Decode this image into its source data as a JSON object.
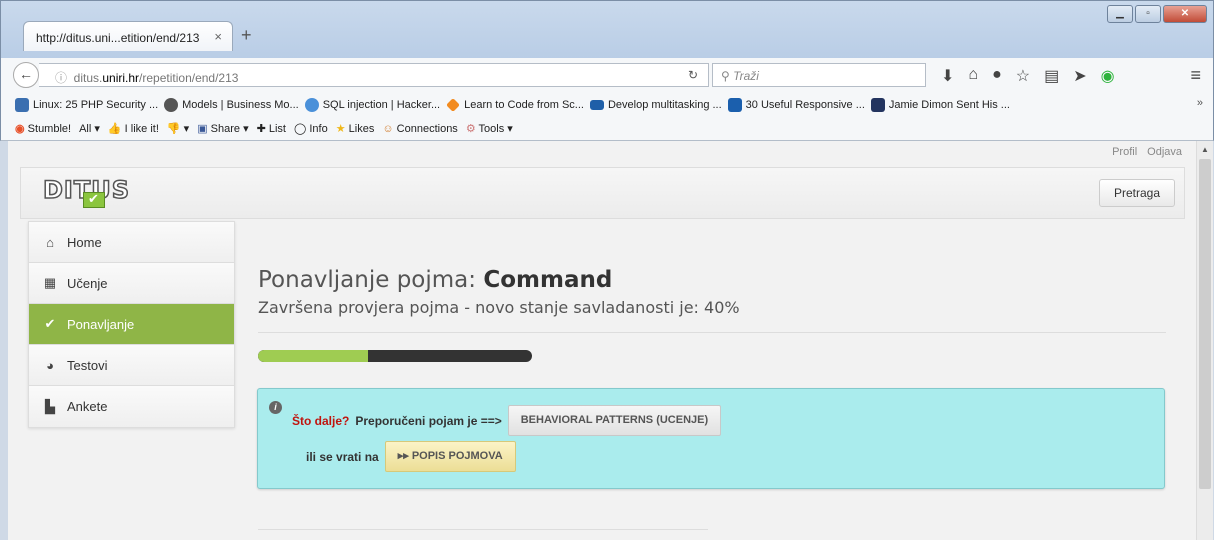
{
  "browser": {
    "tab_title": "http://ditus.uni...etition/end/213",
    "tab_close": "×",
    "new_tab": "+",
    "url_prefix": "ditus.",
    "url_domain": "uniri.hr",
    "url_path": "/repetition/end/213",
    "search_placeholder": "Traži",
    "bookmarks": [
      {
        "label": "Linux: 25 PHP Security ...",
        "color": "#3b6fb0"
      },
      {
        "label": "Models | Business Mo...",
        "color": "#555555"
      },
      {
        "label": "SQL injection | Hacker...",
        "color": "#4a90d9"
      },
      {
        "label": "Learn to Code from Sc...",
        "color": "#f28b20"
      },
      {
        "label": "Develop multitasking ...",
        "color": "#1f5fa8"
      },
      {
        "label": "30 Useful Responsive ...",
        "color": "#1b5fad"
      },
      {
        "label": "Jamie Dimon Sent His ...",
        "color": "#23345f"
      }
    ],
    "toolbar2": {
      "stumble": "Stumble!",
      "all": "All",
      "ilike": "I like it!",
      "share": "Share",
      "list": "List",
      "info": "Info",
      "likes": "Likes",
      "connections": "Connections",
      "tools": "Tools"
    }
  },
  "page": {
    "top_links": {
      "profil": "Profil",
      "odjava": "Odjava"
    },
    "logo_text": "DITUS",
    "search_button": "Pretraga",
    "sidebar": [
      {
        "label": "Home",
        "icon": "home-icon",
        "active": false
      },
      {
        "label": "Učenje",
        "icon": "calendar-icon",
        "active": false
      },
      {
        "label": "Ponavljanje",
        "icon": "check-icon",
        "active": true
      },
      {
        "label": "Testovi",
        "icon": "pie-chart-icon",
        "active": false
      },
      {
        "label": "Ankete",
        "icon": "clipboard-icon",
        "active": false
      }
    ],
    "title_prefix": "Ponavljanje pojma: ",
    "title_term": "Command",
    "subtitle": "Završena provjera pojma - novo stanje savladanosti je: 40%",
    "progress_fraction": 0.4,
    "colors": {
      "progress_fill": "#9fcc52",
      "active_nav": "#8fb547",
      "alert_bg": "#aaeced"
    },
    "alert": {
      "what_next": "Što dalje?",
      "recommended": "Preporučeni pojam je ==>",
      "recommended_button": "BEHAVIORAL PATTERNS (UCENJE)",
      "or_return": "ili se vrati na",
      "list_button": "POPIS POJMOVA"
    }
  }
}
